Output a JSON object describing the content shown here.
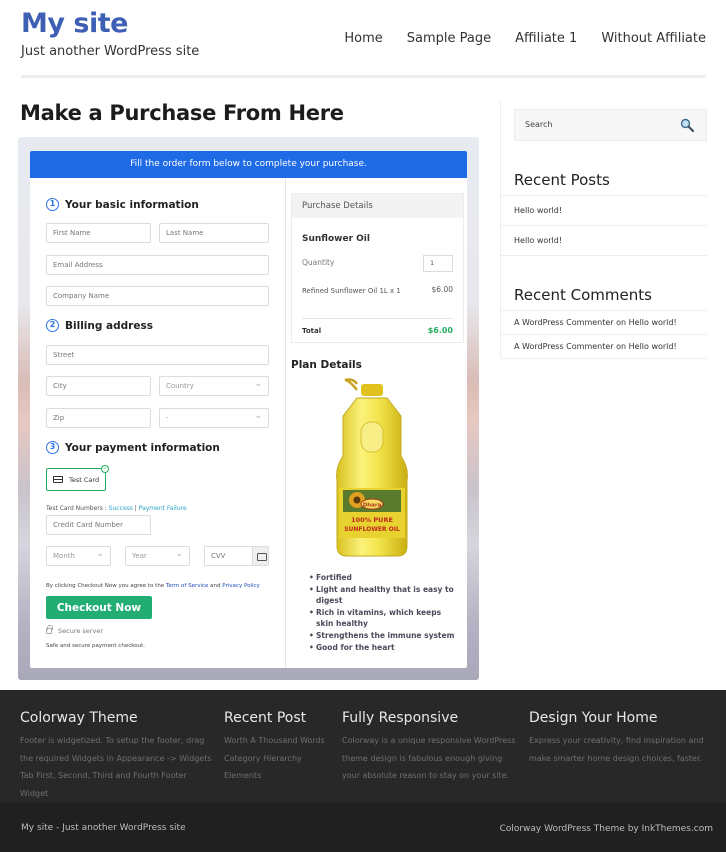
{
  "header": {
    "site_title": "My site",
    "tagline": "Just another WordPress site",
    "nav": [
      "Home",
      "Sample Page",
      "Affiliate 1",
      "Without Affiliate"
    ]
  },
  "page": {
    "title": "Make a Purchase From Here"
  },
  "checkout": {
    "banner": "Fill the order form below to complete your purchase.",
    "steps": [
      {
        "num": "1",
        "label": "Your basic information"
      },
      {
        "num": "2",
        "label": "Billing address"
      },
      {
        "num": "3",
        "label": "Your payment information"
      }
    ],
    "placeholders": {
      "first_name": "First Name",
      "last_name": "Last Name",
      "email": "Email Address",
      "company": "Company Name",
      "street": "Street",
      "city": "City",
      "country": "Country",
      "zip": "Zip",
      "state": "-",
      "card_number": "Credit Card Number",
      "month": "Month",
      "year": "Year",
      "cvv": "CVV"
    },
    "test_card_label": "Test Card",
    "test_numbers_label": "Test Card Numbers : ",
    "test_success": "Success",
    "test_sep": " | ",
    "test_failure": "Payment Failure",
    "terms_prefix": "By clicking Checkout Now you agree to the ",
    "terms_link": "Term of Service",
    "terms_and": " and ",
    "privacy_link": "Privacy Policy",
    "checkout_button": "Checkout Now",
    "secure_label": "Secure server",
    "safe_label": "Safe and secure payment checkout."
  },
  "purchase": {
    "heading": "Purchase Details",
    "product": "Sunflower Oil",
    "quantity_label": "Quantity",
    "quantity": "1",
    "item": "Refined Sunflower Oil 1L x 1",
    "item_price": "$6.00",
    "total_label": "Total",
    "total": "$6.00",
    "plan_title": "Plan Details",
    "bottle_label_top": "100% PURE",
    "bottle_label_bottom": "SUNFLOWER OIL",
    "bottle_brand": "Dhara",
    "features": [
      "Fortified",
      "Light and healthy that is easy to digest",
      "Rich in vitamins, which keeps skin healthy",
      "Strengthens the immune system",
      "Good for the heart"
    ]
  },
  "sidebar": {
    "search_placeholder": "Search",
    "recent_posts_title": "Recent Posts",
    "recent_posts": [
      "Hello world!",
      "Hello world!"
    ],
    "recent_comments_title": "Recent Comments",
    "recent_comments": [
      "A WordPress Commenter on Hello world!",
      "A WordPress Commenter on Hello world!"
    ]
  },
  "footer": {
    "cols": [
      {
        "title": "Colorway Theme",
        "text": "Footer is widgetized. To setup the footer, drag the required Widgets in Appearance -> Widgets Tab First, Second, Third and Fourth Footer Widget"
      },
      {
        "title": "Recent Post",
        "links": [
          "Worth A Thousand Words",
          "Category Hierarchy",
          "Elements"
        ]
      },
      {
        "title": "Fully Responsive",
        "text": "Colorway is a unique responsive WordPress theme design is fabulous enough giving your absolute reason to stay on your site."
      },
      {
        "title": "Design Your Home",
        "text": "Express your creativity, find inspiration and make smarter home design choices, faster."
      }
    ],
    "bottom_left": "My site - Just another WordPress site",
    "bottom_right": "Colorway WordPress Theme by InkThemes.com"
  },
  "colors": {
    "brand": "#3d5fb4",
    "banner": "#1f6be6",
    "checkout_button": "#22ad73",
    "total": "#27ae60",
    "footer_bg": "#282828"
  }
}
